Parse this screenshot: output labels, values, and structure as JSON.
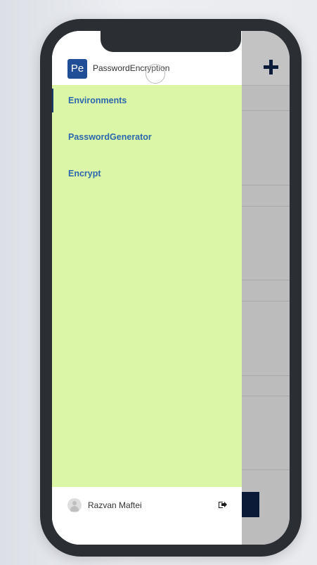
{
  "app": {
    "logo_text": "Pe",
    "name": "PasswordEncryption"
  },
  "nav": {
    "items": [
      {
        "label": "Environments",
        "active": true
      },
      {
        "label": "PasswordGenerator",
        "active": false
      },
      {
        "label": "Encrypt",
        "active": false
      }
    ]
  },
  "footer": {
    "user_name": "Razvan Maftei"
  },
  "background_app": {
    "add_icon": "plus-icon"
  },
  "icons": {
    "avatar": "user-avatar-icon",
    "signout": "sign-out-icon"
  },
  "colors": {
    "nav_background": "#dbf6a7",
    "nav_text": "#2c68ad",
    "logo_background": "#1f4e97",
    "overlay": "#bdbcbc",
    "device_frame": "#2b2f33"
  }
}
